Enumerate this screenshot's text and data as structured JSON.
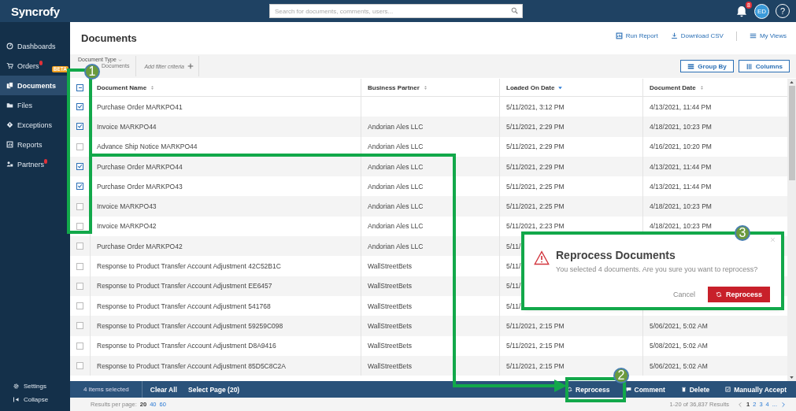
{
  "top_bar": {
    "logo": "Syncrofy",
    "search": {
      "placeholder": "Search for documents, comments, users..."
    },
    "notifications": "8",
    "avatar": "ED",
    "help": "?"
  },
  "sidebar": {
    "items": [
      {
        "label": "Dashboards",
        "selected": false,
        "alert": false
      },
      {
        "label": "Orders",
        "selected": false,
        "alert": true,
        "badge": "BETA"
      },
      {
        "label": "Documents",
        "selected": true,
        "alert": false
      },
      {
        "label": "Files",
        "selected": false,
        "alert": false
      },
      {
        "label": "Exceptions",
        "selected": false,
        "alert": false
      },
      {
        "label": "Reports",
        "selected": false,
        "alert": false
      },
      {
        "label": "Partners",
        "selected": false,
        "alert": true
      }
    ],
    "footer": [
      {
        "label": "Settings"
      },
      {
        "label": "Collapse"
      }
    ]
  },
  "page": {
    "title": "Documents",
    "actions": [
      {
        "label": "Run Report"
      },
      {
        "label": "Download CSV"
      },
      {
        "label": "My Views"
      }
    ]
  },
  "filters": {
    "items": [
      {
        "label": "Document Type",
        "value": "Documents"
      }
    ],
    "add": "Add filter criteria",
    "buttons": [
      {
        "label": "Group By"
      },
      {
        "label": "Columns"
      }
    ]
  },
  "table": {
    "select_all": {
      "indeterminate": true
    },
    "columns": [
      {
        "label": "Document Name",
        "sorted": false
      },
      {
        "label": "Business Partner",
        "sorted": false
      },
      {
        "label": "Loaded On Date",
        "sorted": true
      },
      {
        "label": "Document Date",
        "sorted": false
      }
    ],
    "rows": [
      {
        "checked": true,
        "cells": [
          "Purchase Order MARKPO41",
          "",
          "5/11/2021, 3:12 PM",
          "4/13/2021, 11:44 PM"
        ]
      },
      {
        "checked": true,
        "cells": [
          "Invoice MARKPO44",
          "Andorian Ales LLC",
          "5/11/2021, 2:29 PM",
          "4/18/2021, 10:23 PM"
        ]
      },
      {
        "checked": false,
        "cells": [
          "Advance Ship Notice MARKPO44",
          "Andorian Ales LLC",
          "5/11/2021, 2:29 PM",
          "4/16/2021, 10:20 PM"
        ]
      },
      {
        "checked": true,
        "cells": [
          "Purchase Order MARKPO44",
          "Andorian Ales LLC",
          "5/11/2021, 2:29 PM",
          "4/13/2021, 11:44 PM"
        ]
      },
      {
        "checked": true,
        "cells": [
          "Purchase Order MARKPO43",
          "Andorian Ales LLC",
          "5/11/2021, 2:25 PM",
          "4/13/2021, 11:44 PM"
        ]
      },
      {
        "checked": false,
        "cells": [
          "Invoice MARKPO43",
          "Andorian Ales LLC",
          "5/11/2021, 2:25 PM",
          "4/18/2021, 10:23 PM"
        ]
      },
      {
        "checked": false,
        "cells": [
          "Invoice MARKPO42",
          "Andorian Ales LLC",
          "5/11/2021, 2:23 PM",
          "4/18/2021, 10:23 PM"
        ]
      },
      {
        "checked": false,
        "cells": [
          "Purchase Order MARKPO42",
          "Andorian Ales LLC",
          "5/11/",
          ""
        ]
      },
      {
        "checked": false,
        "cells": [
          "Response to Product Transfer Account Adjustment 42C52B1C",
          "WallStreetBets",
          "5/11/",
          ""
        ]
      },
      {
        "checked": false,
        "cells": [
          "Response to Product Transfer Account Adjustment EE6457",
          "WallStreetBets",
          "5/11/",
          ""
        ]
      },
      {
        "checked": false,
        "cells": [
          "Response to Product Transfer Account Adjustment 541768",
          "WallStreetBets",
          "5/11/",
          ""
        ]
      },
      {
        "checked": false,
        "cells": [
          "Response to Product Transfer Account Adjustment 59259C098",
          "WallStreetBets",
          "5/11/2021, 2:15 PM",
          "5/06/2021, 5:02 AM"
        ]
      },
      {
        "checked": false,
        "cells": [
          "Response to Product Transfer Account Adjustment D8A9416",
          "WallStreetBets",
          "5/11/2021, 2:15 PM",
          "5/08/2021, 5:02 AM"
        ]
      },
      {
        "checked": false,
        "cells": [
          "Response to Product Transfer Account Adjustment 85D5C8C2A",
          "WallStreetBets",
          "5/11/2021, 2:15 PM",
          "5/06/2021, 5:02 AM"
        ]
      }
    ]
  },
  "selection_bar": {
    "count": "4 items selected",
    "links": [
      "Clear All",
      "Select Page (20)"
    ],
    "actions": [
      {
        "label": "Reprocess"
      },
      {
        "label": "Comment"
      },
      {
        "label": "Delete"
      },
      {
        "label": "Manually Accept"
      }
    ]
  },
  "pager": {
    "label": "Results per page:",
    "sizes": [
      {
        "label": "20",
        "selected": true
      },
      {
        "label": "40",
        "selected": false
      },
      {
        "label": "60",
        "selected": false
      }
    ],
    "summary": "1-20 of 36,837 Results",
    "pages": [
      {
        "label": "1",
        "selected": true
      },
      {
        "label": "2",
        "selected": false
      },
      {
        "label": "3",
        "selected": false
      },
      {
        "label": "4",
        "selected": false
      }
    ],
    "ellipsis": "..."
  },
  "dialog": {
    "title": "Reprocess Documents",
    "message": "You selected 4 documents. Are you sure you want to reprocess?",
    "cancel": "Cancel",
    "confirm": "Reprocess"
  },
  "annotations": {
    "badges": [
      "1",
      "2",
      "3"
    ]
  }
}
